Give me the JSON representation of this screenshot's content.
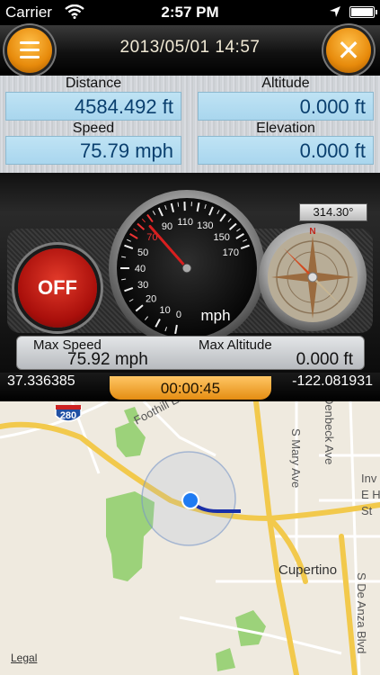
{
  "status_bar": {
    "carrier": "Carrier",
    "time": "2:57 PM",
    "icons": [
      "wifi-icon",
      "location-arrow-icon",
      "battery-icon"
    ]
  },
  "header": {
    "datetime": "2013/05/01 14:57",
    "menu_icon": "menu-icon",
    "close_icon": "close-icon",
    "accent_color": "#e78a0b"
  },
  "info": {
    "distance_label": "Distance",
    "distance_value": "4584.492 ft",
    "altitude_label": "Altitude",
    "altitude_value": "0.000 ft",
    "speed_label": "Speed",
    "speed_value": "75.79 mph",
    "elevation_label": "Elevation",
    "elevation_value": "0.000 ft"
  },
  "speedometer": {
    "unit": "mph",
    "ticks": [
      "0",
      "10",
      "20",
      "30",
      "40",
      "50",
      "70",
      "90",
      "110",
      "130",
      "150",
      "170"
    ],
    "needle_value": 75.79
  },
  "compass": {
    "heading": "314.30°",
    "north_label": "N"
  },
  "toggle": {
    "label": "OFF"
  },
  "max": {
    "speed_label": "Max Speed",
    "speed_value": "75.92 mph",
    "altitude_label": "Max Altitude",
    "altitude_value": "0.000 ft"
  },
  "coords": {
    "latitude": "37.336385",
    "longitude": "-122.081931",
    "elapsed": "00:00:45"
  },
  "map": {
    "shield": "280",
    "labels": {
      "foothill": "Foothill Expy",
      "mary": "S Mary Ave",
      "beck": "Denbeck Ave",
      "cupertino": "Cupertino",
      "deanza": "S De Anza Blvd",
      "inv": "Inv",
      "eh": "E H",
      "st": "St"
    },
    "legal": "Legal"
  }
}
